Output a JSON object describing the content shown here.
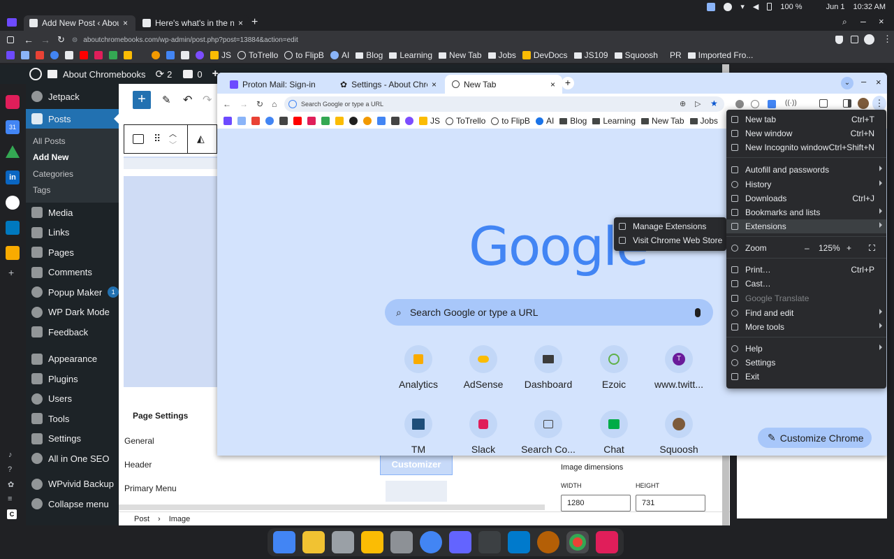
{
  "system": {
    "battery": "100 %",
    "date": "Jun 1",
    "time": "10:32 AM"
  },
  "outer_tabs": [
    {
      "label": "Add New Post ‹ About"
    },
    {
      "label": "Here's what's in the new"
    }
  ],
  "outer_address": "aboutchromebooks.com/wp-admin/post.php?post=13884&action=edit",
  "outer_bookmarks": [
    "JS",
    "ToTrello",
    "to FlipB",
    "AI",
    "Blog",
    "Learning",
    "New Tab",
    "Jobs",
    "DevDocs",
    "JS109",
    "Squoosh",
    "PR",
    "Imported Fro..."
  ],
  "wp_bar": {
    "site": "About Chromebooks",
    "updates": "2",
    "comments": "0"
  },
  "wp_menu": {
    "jetpack": "Jetpack",
    "posts": "Posts",
    "posts_sub": [
      "All Posts",
      "Add New",
      "Categories",
      "Tags"
    ],
    "items": [
      "Media",
      "Links",
      "Pages",
      "Comments",
      "Popup Maker",
      "WP Dark Mode",
      "Feedback",
      "Appearance",
      "Plugins",
      "Users",
      "Tools",
      "Settings",
      "All in One SEO",
      "WPvivid Backup",
      "Collapse menu"
    ],
    "popup_badge": "1"
  },
  "editor": {
    "page_settings": "Page Settings",
    "settings_items": [
      "General",
      "Header",
      "Primary Menu"
    ],
    "breadcrumb": [
      "Post",
      "Image"
    ],
    "image_dimensions": "Image dimensions",
    "width_label": "WIDTH",
    "height_label": "HEIGHT",
    "width_value": "1280",
    "height_value": "731",
    "customizer": "Customizer"
  },
  "inner_tabs": [
    {
      "label": "Proton Mail: Sign-in"
    },
    {
      "label": "Settings - About Chro"
    },
    {
      "label": "New Tab"
    }
  ],
  "inner_omnibox_placeholder": "Search Google or type a URL",
  "inner_bookmarks": [
    "JS",
    "ToTrello",
    "to FlipB",
    "AI",
    "Blog",
    "Learning",
    "New Tab",
    "Jobs"
  ],
  "ntp": {
    "logo": "Google",
    "search_placeholder": "Search Google or type a URL",
    "tiles_row1": [
      "Analytics",
      "AdSense",
      "Dashboard",
      "Ezoic",
      "www.twitt..."
    ],
    "tiles_row2": [
      "TM",
      "Slack",
      "Search Co...",
      "Chat",
      "Squoosh"
    ],
    "twitter_letter": "T",
    "customize": "Customize Chrome"
  },
  "menu": {
    "new_tab": {
      "label": "New tab",
      "shortcut": "Ctrl+T"
    },
    "new_window": {
      "label": "New window",
      "shortcut": "Ctrl+N"
    },
    "incognito": {
      "label": "New Incognito window",
      "shortcut": "Ctrl+Shift+N"
    },
    "autofill": "Autofill and passwords",
    "history": "History",
    "downloads": {
      "label": "Downloads",
      "shortcut": "Ctrl+J"
    },
    "bookmarks": "Bookmarks and lists",
    "extensions": "Extensions",
    "zoom": {
      "label": "Zoom",
      "minus": "–",
      "value": "125%",
      "plus": "+"
    },
    "print": {
      "label": "Print…",
      "shortcut": "Ctrl+P"
    },
    "cast": "Cast…",
    "translate": "Google Translate",
    "find": "Find and edit",
    "more_tools": "More tools",
    "help": "Help",
    "settings": "Settings",
    "exit": "Exit"
  },
  "extensions_submenu": [
    "Manage Extensions",
    "Visit Chrome Web Store"
  ],
  "colors": {
    "wp_dark": "#1d2327",
    "wp_blue": "#2271b1",
    "chrome_blue": "#d3e3fd",
    "google_blue": "#4285f4"
  }
}
